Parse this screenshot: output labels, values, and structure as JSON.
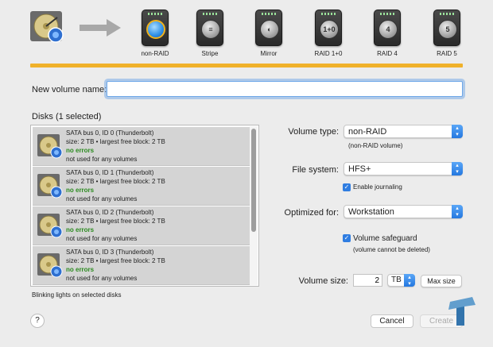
{
  "raid_types": [
    {
      "label": "non-RAID",
      "glyph": "",
      "selected": true
    },
    {
      "label": "Stripe",
      "glyph": "≡",
      "selected": false
    },
    {
      "label": "Mirror",
      "glyph": "◐",
      "selected": false
    },
    {
      "label": "RAID 1+0",
      "glyph": "1+0",
      "selected": false
    },
    {
      "label": "RAID 4",
      "glyph": "4",
      "selected": false
    },
    {
      "label": "RAID 5",
      "glyph": "5",
      "selected": false
    }
  ],
  "volume_name": {
    "label": "New volume name:",
    "value": ""
  },
  "disks_heading": "Disks (1 selected)",
  "disks": [
    {
      "title": "SATA bus 0, ID 0 (Thunderbolt)",
      "size": "size: 2 TB • largest free block: 2 TB",
      "status": "no errors",
      "usage": "not used for any volumes"
    },
    {
      "title": "SATA bus 0, ID 1 (Thunderbolt)",
      "size": "size: 2 TB • largest free block: 2 TB",
      "status": "no errors",
      "usage": "not used for any volumes"
    },
    {
      "title": "SATA bus 0, ID 2 (Thunderbolt)",
      "size": "size: 2 TB • largest free block: 2 TB",
      "status": "no errors",
      "usage": "not used for any volumes"
    },
    {
      "title": "SATA bus 0, ID 3 (Thunderbolt)",
      "size": "size: 2 TB • largest free block: 2 TB",
      "status": "no errors",
      "usage": "not used for any volumes"
    }
  ],
  "blink_label": "Blinking lights on selected disks",
  "volume_type": {
    "label": "Volume type:",
    "value": "non-RAID",
    "note": "(non-RAID volume)"
  },
  "file_system": {
    "label": "File system:",
    "value": "HFS+",
    "journaling_label": "Enable journaling",
    "journaling_checked": true
  },
  "optimized_for": {
    "label": "Optimized for:",
    "value": "Workstation"
  },
  "safeguard": {
    "label": "Volume safeguard",
    "note": "(volume cannot be deleted)",
    "checked": true
  },
  "volume_size": {
    "label": "Volume size:",
    "value": "2",
    "unit": "TB",
    "max_label": "Max size"
  },
  "footer": {
    "help_label": "?",
    "cancel_label": "Cancel",
    "create_label": "Create"
  },
  "colors": {
    "accent": "#2f7de1",
    "progress": "#f0b12a",
    "status_ok": "#2a8a1e"
  }
}
